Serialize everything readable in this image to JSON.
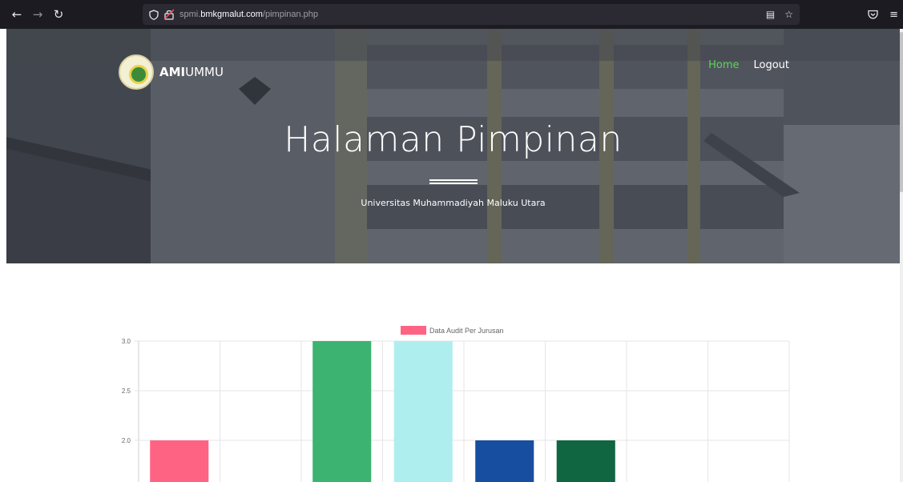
{
  "browser": {
    "url_prefix": "spmi.",
    "url_host": "bmkgmalut.com",
    "url_path": "/pimpinan.php"
  },
  "header": {
    "brand_bold": "AMI",
    "brand_rest": "UMMU",
    "nav": [
      {
        "label": "Home",
        "active": true
      },
      {
        "label": "Logout",
        "active": false
      }
    ]
  },
  "hero": {
    "title": "Halaman Pimpinan",
    "subtitle": "Universitas Muhammadiyah Maluku Utara"
  },
  "colors": {
    "nav_active": "#5fd35a"
  },
  "chart_data": {
    "type": "bar",
    "legend_label": "Data Audit Per Jurusan",
    "legend_color": "#ff6384",
    "ylim_visible": [
      1.55,
      3.0
    ],
    "yticks": [
      "3.0",
      "2.5",
      "2.0"
    ],
    "categories": [
      "",
      "",
      "",
      "",
      "",
      "",
      "",
      ""
    ],
    "values": [
      2,
      null,
      3,
      3,
      2,
      2,
      null,
      null
    ],
    "colors": [
      "#ff6384",
      "#cccccc",
      "#3cb371",
      "#afeeee",
      "#174ea0",
      "#0f6640",
      "#cccccc",
      "#cccccc"
    ]
  }
}
